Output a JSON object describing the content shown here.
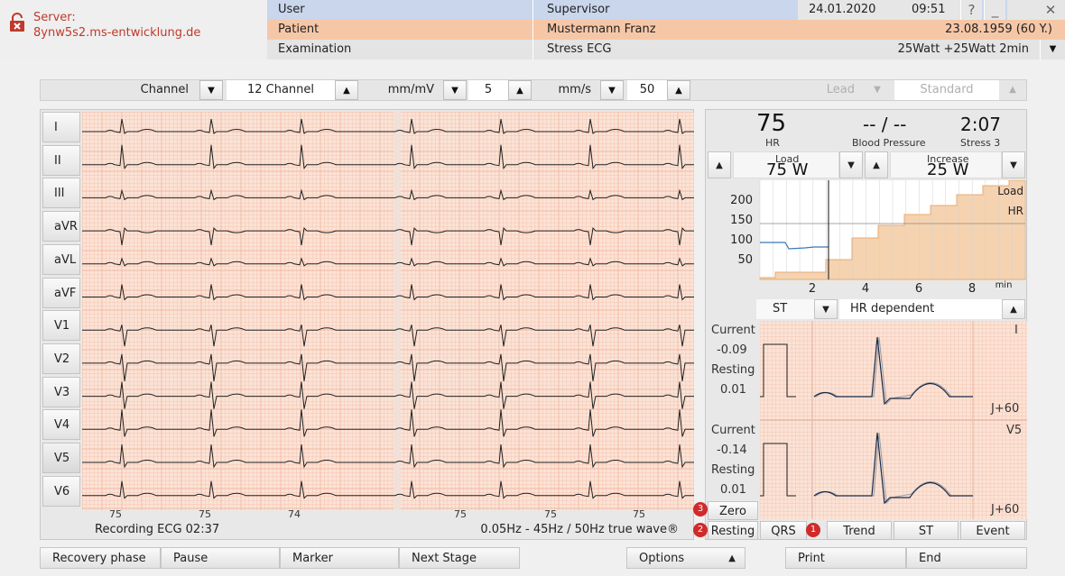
{
  "server": {
    "label": "Server:",
    "host": "8ynw5s2.ms-entwicklung.de"
  },
  "header": {
    "user_label": "User",
    "user_value": "Supervisor",
    "date": "24.01.2020",
    "time": "09:51",
    "patient_label": "Patient",
    "patient_value": "Mustermann Franz",
    "dob": "23.08.1959 (60 Y.)",
    "exam_label": "Examination",
    "exam_value": "Stress ECG",
    "exam_detail": "25Watt  +25Watt  2min",
    "help": "?",
    "minimize": "_",
    "close": "✕"
  },
  "toolbar": {
    "channel_label": "Channel",
    "channel_value": "12 Channel",
    "gain_label": "mm/mV",
    "gain_value": "5",
    "speed_label": "mm/s",
    "speed_value": "50",
    "lead_label": "Lead",
    "standard_value": "Standard"
  },
  "leads": [
    "I",
    "II",
    "III",
    "aVR",
    "aVL",
    "aVF",
    "V1",
    "V2",
    "V3",
    "V4",
    "V5",
    "V6"
  ],
  "selected_lead": "V5",
  "ecg": {
    "tick_labels": [
      "75",
      "75",
      "74",
      "75",
      "75",
      "75"
    ],
    "recording": "Recording ECG   02:37",
    "filter": "0.05Hz - 45Hz / 50Hz true wave®"
  },
  "vitals": {
    "hr_value": "75",
    "hr_label": "HR",
    "bp_value": "-- / --",
    "bp_label": "Blood Pressure",
    "time_value": "2:07",
    "stage_label": "Stress 3",
    "load_label": "Load",
    "load_value": "75 W",
    "increase_label": "Increase",
    "increase_value": "25 W"
  },
  "trend_chart": {
    "yticks": [
      "200",
      "150",
      "100",
      "50"
    ],
    "xticks": [
      "2",
      "4",
      "6",
      "8"
    ],
    "xunit": "min",
    "legend_load": "Load",
    "legend_hr": "HR"
  },
  "st": {
    "st_label": "ST",
    "mode_value": "HR dependent",
    "lead1_name": "I",
    "lead2_name": "V5",
    "current_label": "Current",
    "resting_label": "Resting",
    "lead1_current": "-0.09",
    "lead1_resting": "0.01",
    "lead2_current": "-0.14",
    "lead2_resting": "0.01",
    "jpoint": "J+60"
  },
  "tabs": {
    "zero": "Zero",
    "resting": "Resting",
    "qrs": "QRS",
    "trend": "Trend",
    "st": "ST",
    "event": "Event"
  },
  "badges": {
    "b1": "1",
    "b2": "2",
    "b3": "3"
  },
  "bottom": {
    "recovery": "Recovery phase",
    "pause": "Pause",
    "marker": "Marker",
    "next_stage": "Next Stage",
    "options": "Options",
    "print": "Print",
    "end": "End"
  },
  "colors": {
    "ecg_paper": "#fbe3d6",
    "ecg_grid": "#f2b9a3",
    "patient_row": "#f6c7a7",
    "user_row": "#c9d6ec",
    "badge": "#d12a2a"
  }
}
